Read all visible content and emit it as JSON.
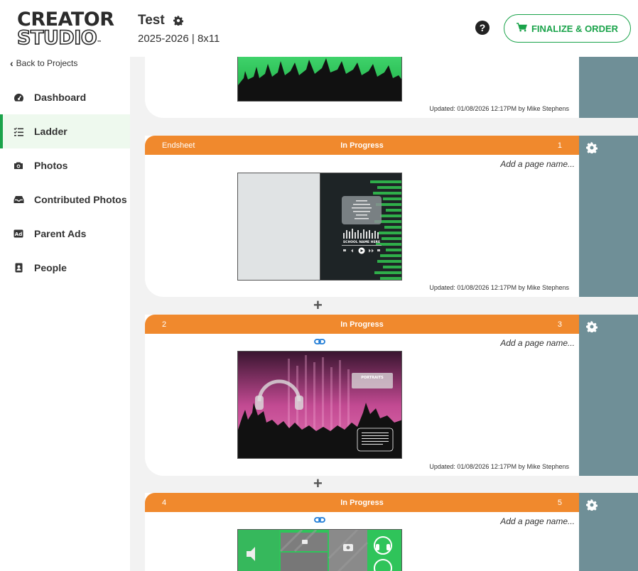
{
  "logo": {
    "line1": "CREATOR",
    "line2": "STUDIO",
    "tm": "™"
  },
  "sidebar": {
    "back_label": "Back to Projects",
    "items": [
      {
        "label": "Dashboard",
        "icon": "dashboard-icon"
      },
      {
        "label": "Ladder",
        "icon": "ladder-list-icon",
        "active": true
      },
      {
        "label": "Photos",
        "icon": "camera-icon"
      },
      {
        "label": "Contributed Photos",
        "icon": "inbox-icon"
      },
      {
        "label": "Parent Ads",
        "icon": "ad-icon"
      },
      {
        "label": "People",
        "icon": "person-badge-icon"
      }
    ]
  },
  "header": {
    "title": "Test",
    "subtitle": "2025-2026 | 8x11",
    "help": "?",
    "finalize_label": "FINALIZE & ORDER"
  },
  "colors": {
    "accent_green": "#1aa34a",
    "bar_orange": "#f0892d",
    "side_panel": "#6f8f97"
  },
  "cards": [
    {
      "updated": "Updated: 01/08/2026 12:17PM by Mike Stephens"
    },
    {
      "left": "Endsheet",
      "status": "In Progress",
      "right": "1",
      "page_name_placeholder": "Add a page name...",
      "updated": "Updated: 01/08/2026 12:17PM by Mike Stephens",
      "thumb_text": "SCHOOL NAME HERE"
    },
    {
      "left": "2",
      "status": "In Progress",
      "right": "3",
      "page_name_placeholder": "Add a page name...",
      "updated": "Updated: 01/08/2026 12:17PM by Mike Stephens",
      "thumb_text": "PORTRAITS"
    },
    {
      "left": "4",
      "status": "In Progress",
      "right": "5",
      "page_name_placeholder": "Add a page name..."
    }
  ],
  "plus_symbol": "+"
}
